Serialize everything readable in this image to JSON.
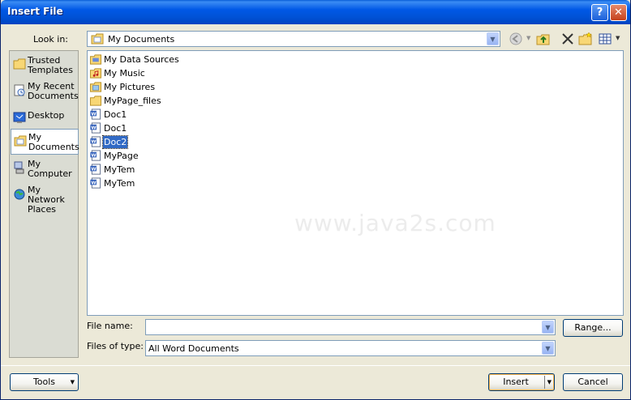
{
  "window": {
    "title": "Insert File"
  },
  "titlebar": {
    "help_glyph": "?",
    "close_glyph": "✕"
  },
  "lookin": {
    "label": "Look in:",
    "value": "My Documents"
  },
  "places": [
    {
      "line1": "Trusted",
      "line2": "Templates",
      "icon": "trusted-templates-icon"
    },
    {
      "line1": "My Recent",
      "line2": "Documents",
      "icon": "recent-documents-icon"
    },
    {
      "line1": "Desktop",
      "line2": "",
      "icon": "desktop-icon"
    },
    {
      "line1": "My",
      "line2": "Documents",
      "icon": "my-documents-icon"
    },
    {
      "line1": "My",
      "line2": "Computer",
      "icon": "computer-icon"
    },
    {
      "line1": "My Network",
      "line2": "Places",
      "icon": "network-places-icon"
    }
  ],
  "files": [
    {
      "name": "My Data Sources",
      "icon": "data-sources-folder-icon"
    },
    {
      "name": "My Music",
      "icon": "music-folder-icon"
    },
    {
      "name": "My Pictures",
      "icon": "pictures-folder-icon"
    },
    {
      "name": "MyPage_files",
      "icon": "folder-icon"
    },
    {
      "name": "Doc1",
      "icon": "word-document-icon"
    },
    {
      "name": "Doc1",
      "icon": "word-document-icon"
    },
    {
      "name": "Doc2",
      "icon": "word-document-icon"
    },
    {
      "name": "MyPage",
      "icon": "word-document-icon"
    },
    {
      "name": "MyTem",
      "icon": "word-document-icon"
    },
    {
      "name": "MyTem",
      "icon": "word-document-icon"
    }
  ],
  "selected_file_index": 6,
  "watermark": "www.java2s.com",
  "filename": {
    "label": "File name:",
    "value": ""
  },
  "filetype": {
    "label": "Files of type:",
    "value": "All Word Documents"
  },
  "buttons": {
    "range": "Range...",
    "tools": "Tools",
    "insert": "Insert",
    "cancel": "Cancel"
  },
  "colors": {
    "title_blue": "#0058e6",
    "selection": "#316ac5",
    "dialog_bg": "#ece9d8"
  }
}
